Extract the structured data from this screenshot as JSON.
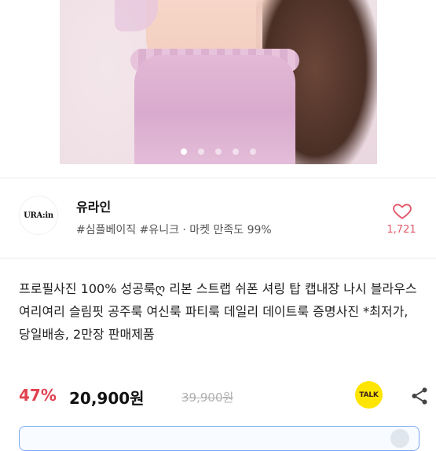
{
  "product_image": {
    "carousel_total": 5,
    "carousel_active_index": 1
  },
  "seller": {
    "logo_text": "URA:in",
    "name": "유라인",
    "tags": "#심플베이직 #유니크 · 마켓 만족도 99%",
    "favorite_count": "1,721",
    "heart_color": "#e25a6c"
  },
  "product": {
    "title": "프로필사진 100% 성공룩ღ 리본 스트랩 쉬폰 셔링 탑 캡내장 나시 블라우스 여리여리 슬림핏 공주룩 여신룩 파티룩 데일리 데이트룩 증명사진 *최저가, 당일배송, 2만장 판매제품",
    "discount": "47%",
    "price": "20,900원",
    "original_price": "39,900원",
    "discount_color": "#e0434f"
  },
  "actions": {
    "talk_label": "TALK",
    "talk_color": "#fee500",
    "share_icon": "share-icon"
  }
}
